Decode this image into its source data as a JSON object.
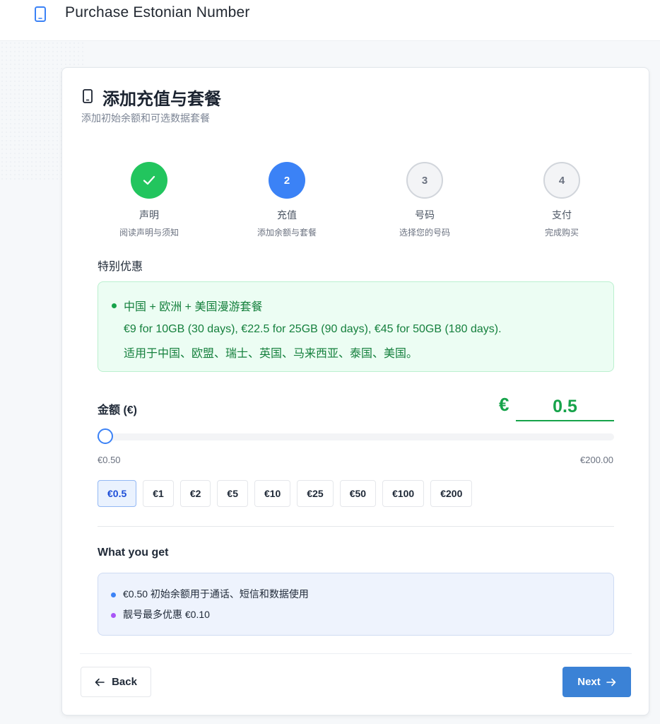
{
  "app": {
    "title": "Purchase Estonian Number",
    "icon": "phone-icon"
  },
  "card": {
    "title": "添加充值与套餐",
    "subtitle": "添加初始余额和可选数据套餐"
  },
  "steps": [
    {
      "number": "1",
      "label": "声明",
      "desc": "阅读声明与须知",
      "state": "done"
    },
    {
      "number": "2",
      "label": "充值",
      "desc": "添加余额与套餐",
      "state": "active"
    },
    {
      "number": "3",
      "label": "号码",
      "desc": "选择您的号码",
      "state": "todo"
    },
    {
      "number": "4",
      "label": "支付",
      "desc": "完成购买",
      "state": "todo"
    }
  ],
  "promo": {
    "section_title": "特别优惠",
    "title": "中国 + 欧洲 + 美国漫游套餐",
    "line1": "€9 for 10GB (30 days), €22.5 for 25GB (90 days), €45 for 50GB (180 days).",
    "line2": "适用于中国、欧盟、瑞士、英国、马来西亚、泰国、美国。",
    "color": "#16a34a"
  },
  "amount": {
    "label": "金额 (€)",
    "currency": "€",
    "value": "0.5",
    "min": 0.5,
    "max": 200,
    "min_label": "€0.50",
    "max_label": "€200.00",
    "presets": [
      "€0.5",
      "€1",
      "€2",
      "€5",
      "€10",
      "€25",
      "€50",
      "€100",
      "€200"
    ],
    "selected_index": 0
  },
  "what_you_get": {
    "title": "What you get",
    "items": [
      {
        "text": "€0.50 初始余额用于通话、短信和数据使用",
        "color": "#3b82f6"
      },
      {
        "text": "靓号最多优惠 €0.10",
        "color": "#a855f7"
      }
    ]
  },
  "nav": {
    "back_label": "Back",
    "next_label": "Next",
    "next_color": "#3b82d6"
  }
}
